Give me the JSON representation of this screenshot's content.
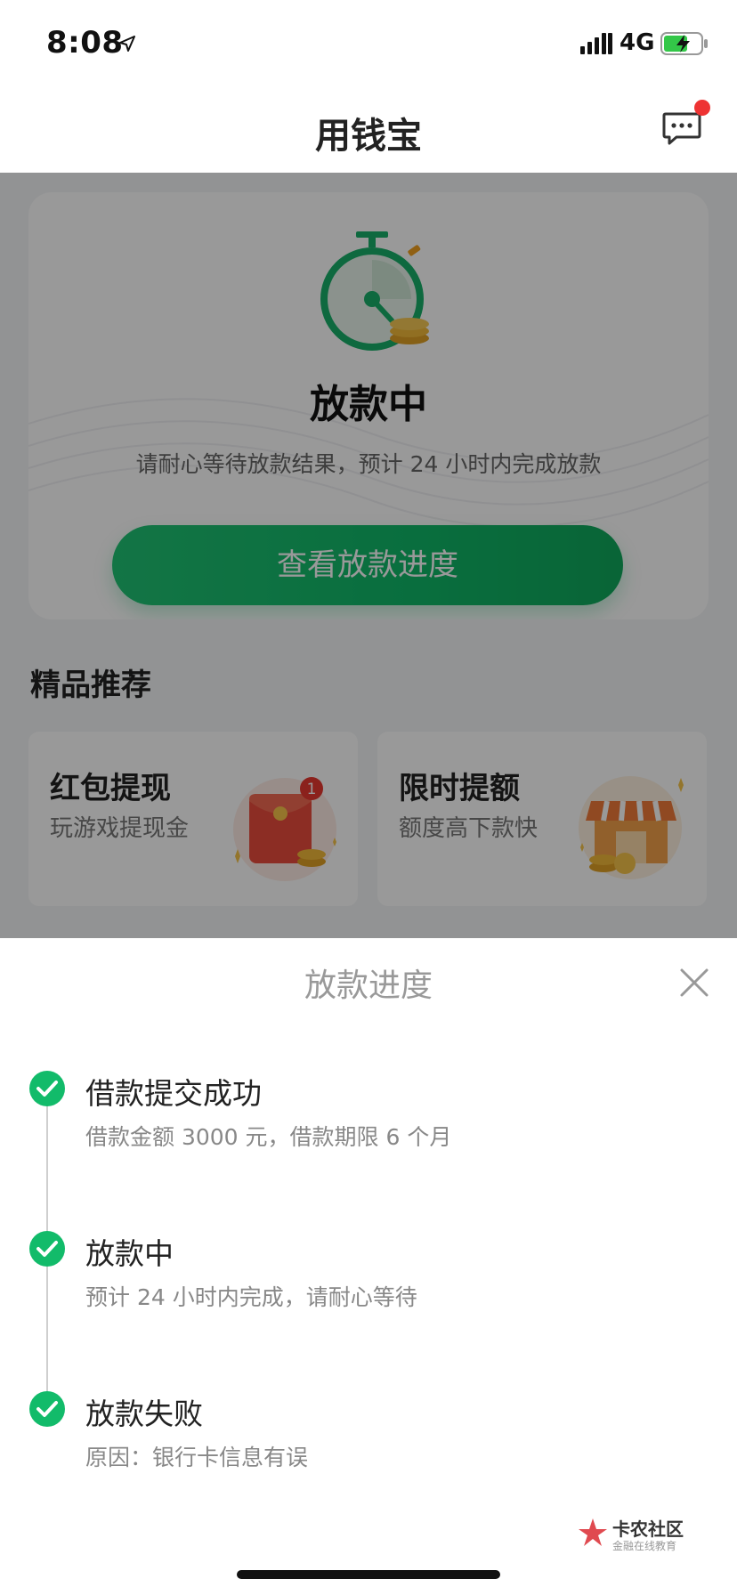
{
  "status_bar": {
    "time": "8:08",
    "network": "4G",
    "icons": [
      "location-arrow-icon",
      "signal-icon",
      "battery-charging-icon"
    ]
  },
  "nav": {
    "title": "用钱宝",
    "message_icon": "chat-bubble-icon",
    "has_unread": true
  },
  "loan_status_card": {
    "icon": "stopwatch-coins-icon",
    "status": "放款中",
    "description": "请耐心等待放款结果，预计 24 小时内完成放款",
    "button_label": "查看放款进度"
  },
  "recommend": {
    "title": "精品推荐",
    "items": [
      {
        "title": "红包提现",
        "subtitle": "玩游戏提现金",
        "icon": "red-envelope-icon",
        "badge": "1"
      },
      {
        "title": "限时提额",
        "subtitle": "额度高下款快",
        "icon": "storefront-icon"
      }
    ]
  },
  "progress_sheet": {
    "title": "放款进度",
    "close_icon": "close-icon",
    "steps": [
      {
        "title": "借款提交成功",
        "desc": "借款金额 3000 元，借款期限 6 个月",
        "icon": "check-circle-icon"
      },
      {
        "title": "放款中",
        "desc": "预计 24 小时内完成，请耐心等待",
        "icon": "check-circle-icon"
      },
      {
        "title": "放款失败",
        "desc": "原因：银行卡信息有误",
        "icon": "check-circle-icon"
      }
    ]
  },
  "watermark": {
    "text": "卡农社区",
    "sub": "金融在线教育"
  },
  "colors": {
    "accent_green": "#10b868",
    "badge_red": "#ee3333",
    "overlay": "rgba(0,0,0,0.40)"
  }
}
